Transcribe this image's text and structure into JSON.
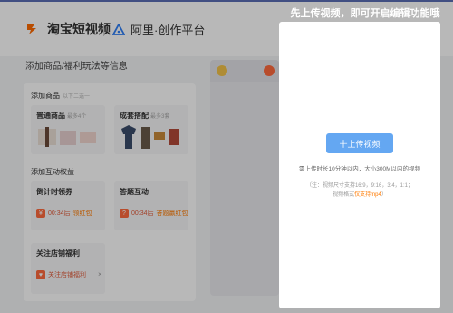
{
  "header": {
    "brand": "淘宝短视频",
    "platform": "阿里·创作平台"
  },
  "page": {
    "section_title": "添加商品/福利玩法等信息"
  },
  "groups": {
    "products": {
      "title": "添加商品",
      "hint": "以下二选一",
      "cards": [
        {
          "title": "普通商品",
          "sub": "最多4个"
        },
        {
          "title": "成套搭配",
          "sub": "最多3套"
        }
      ]
    },
    "interactive": {
      "title": "添加互动权益",
      "cards": [
        {
          "title": "倒计时领券",
          "time": "00:34后",
          "link": "领红包"
        },
        {
          "title": "答题互动",
          "time": "00:34后",
          "link": "答题赢红包"
        }
      ]
    },
    "follow": {
      "title": "关注店铺福利",
      "item": "关注店铺福利"
    }
  },
  "upload": {
    "title": "先上传视频，即可开启编辑功能哦",
    "button": "十上传视频",
    "rule": "需上传时长10分钟以内，大小300M以内的视频",
    "note_line1": "（注：视频尺寸支持16:9，9:16，3:4，1:1；",
    "note_line2_prefix": "视频格式",
    "note_line2_highlight": "仅支持mp4",
    "note_line2_suffix": "）"
  },
  "colors": {
    "accent": "#64a7f2",
    "highlight": "#ff7a00",
    "brand_orange": "#ff6a00",
    "brand_blue": "#2f7ef5"
  }
}
